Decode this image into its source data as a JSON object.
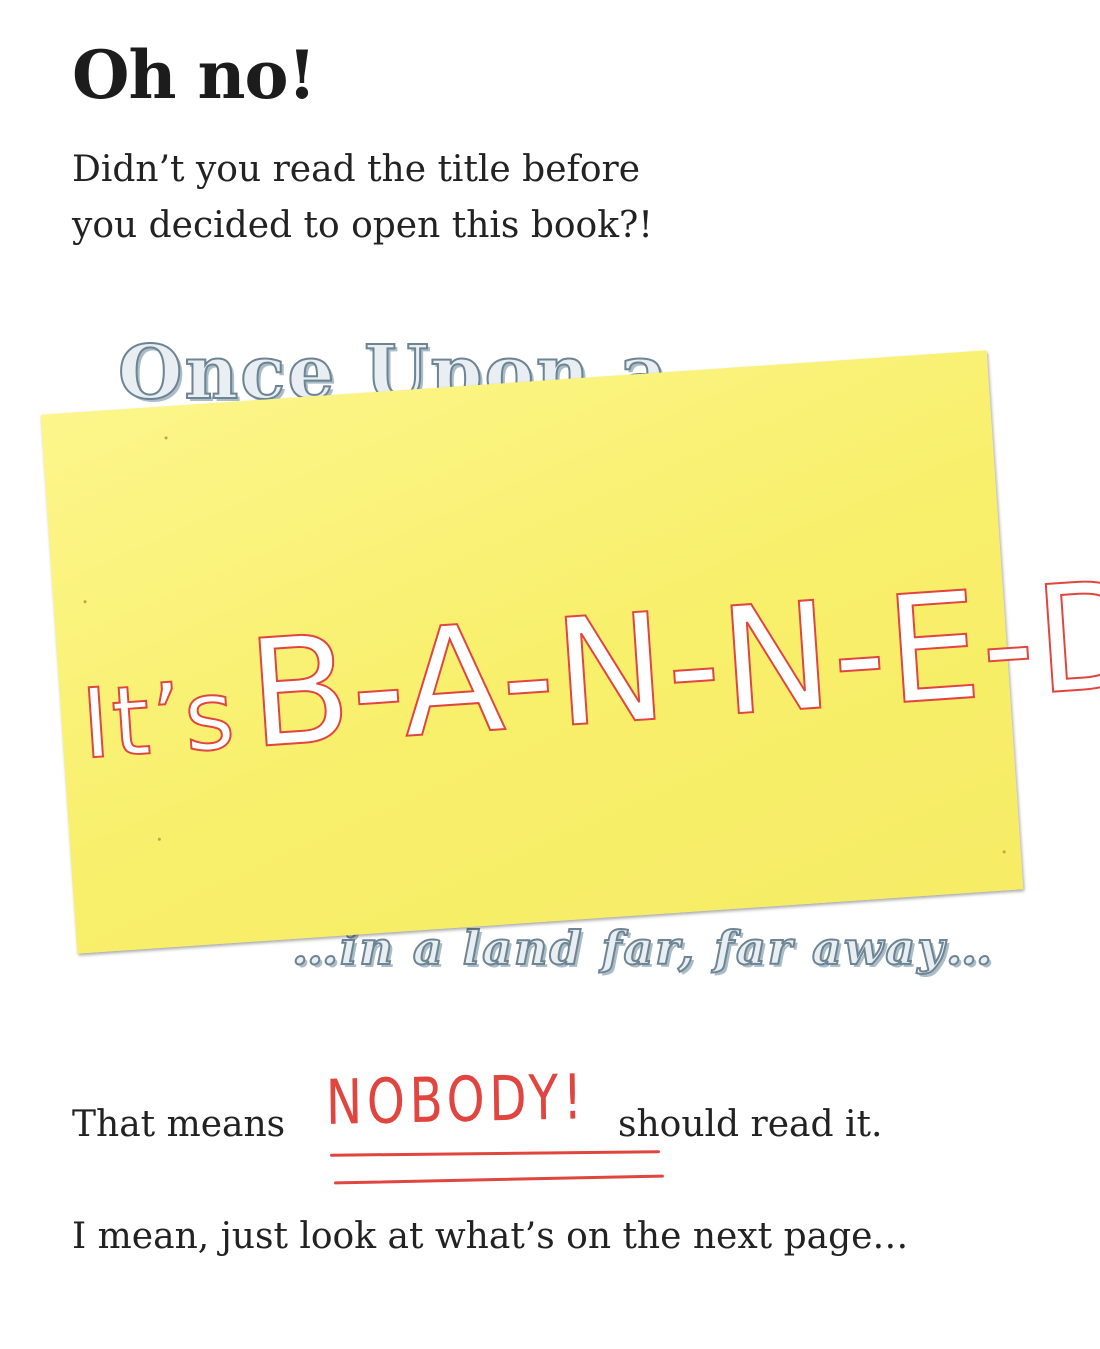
{
  "heading": "Oh no!",
  "intro": {
    "line1": "Didn’t you read the title before",
    "line2": "you decided to open this book?!"
  },
  "background_title": {
    "top": "Once Upon a",
    "bottom": "…in a land far, far away…"
  },
  "note": {
    "prefix": "It’s",
    "word": "B-A-N-N-E-D."
  },
  "body": {
    "line1_before": "That means",
    "line1_emphasis": "NOBODY!",
    "line1_after": "should read it.",
    "line2": "I mean, just look at what’s on the next page…"
  },
  "colors": {
    "note": "#fbf47a",
    "ink_red": "#e0463f",
    "text": "#222222",
    "bg_title_outline": "#6d8493"
  }
}
